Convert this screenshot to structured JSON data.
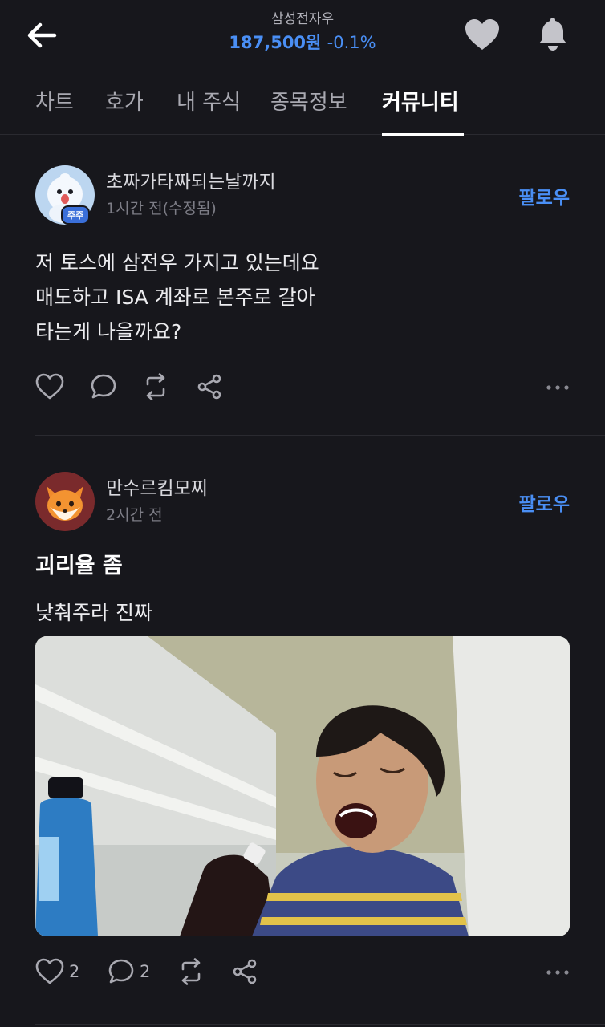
{
  "header": {
    "stock_name": "삼성전자우",
    "price": "187,500원",
    "change": "-0.1%"
  },
  "tabs": [
    {
      "label": "차트"
    },
    {
      "label": "호가"
    },
    {
      "label": "내 주식"
    },
    {
      "label": "종목정보"
    },
    {
      "label": "커뮤니티",
      "active": true
    }
  ],
  "posts": [
    {
      "author": "초짜가타짜되는날까지",
      "badge": "주주",
      "time": "1시간 전(수정됨)",
      "follow": "팔로우",
      "body": "저 토스에 삼전우 가지고 있는데요\n매도하고 ISA 계좌로 본주로 갈아\n타는게 나을까요?",
      "likes": "",
      "comments": ""
    },
    {
      "author": "만수르킴모찌",
      "time": "2시간 전",
      "follow": "팔로우",
      "title": "괴리율 좀",
      "body": "낮춰주라 진짜",
      "likes": "2",
      "comments": "2"
    }
  ],
  "colors": {
    "background": "#17171c",
    "accent": "#4a8ff5",
    "text": "#ececef",
    "muted": "#7d7d86"
  },
  "icons": [
    "back-arrow-icon",
    "heart-icon",
    "bell-icon",
    "comment-icon",
    "repost-icon",
    "share-icon",
    "more-icon"
  ]
}
